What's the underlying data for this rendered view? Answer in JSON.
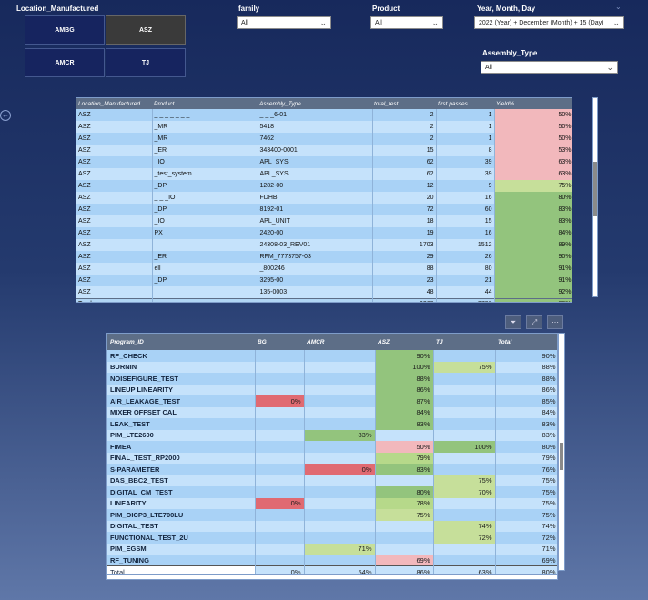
{
  "slicers": {
    "location": {
      "title": "Location_Manufactured",
      "tiles": [
        "AMBG",
        "ASZ",
        "AMCR",
        "TJ"
      ]
    },
    "family": {
      "title": "family",
      "value": "All"
    },
    "product": {
      "title": "Product",
      "value": "All"
    },
    "date": {
      "title": "Year, Month, Day",
      "value": "2022 (Year) + December (Month) + 15 (Day)"
    },
    "assembly": {
      "title": "Assembly_Type",
      "value": "All"
    }
  },
  "icons": {
    "chevron": "chevron-down-icon",
    "back": "back-arrow-icon",
    "filter": "filter-icon",
    "focus": "focus-mode-icon",
    "more": "more-options-icon"
  },
  "colors": {
    "red": "#e06a72",
    "pink": "#f2b8bc",
    "lightgreen": "#c6df9a",
    "green": "#93c47d",
    "lime": "#b6d98a"
  },
  "table1": {
    "headers": [
      "Location_Manufactured",
      "Product",
      "Assembly_Type",
      "total_test",
      "first passes",
      "Yield%"
    ],
    "rows": [
      [
        "ASZ",
        "_ _ _ _ _ _ _",
        "_ _ _6-01",
        "2",
        "1",
        "50%",
        "pink"
      ],
      [
        "ASZ",
        "_MR",
        "5418",
        "2",
        "1",
        "50%",
        "pink"
      ],
      [
        "ASZ",
        "_MR",
        "7462",
        "2",
        "1",
        "50%",
        "pink"
      ],
      [
        "ASZ",
        "_ER",
        "343400-0001",
        "15",
        "8",
        "53%",
        "pink"
      ],
      [
        "ASZ",
        "_IO",
        "APL_SYS",
        "62",
        "39",
        "63%",
        "pink"
      ],
      [
        "ASZ",
        "_test_system",
        "APL_SYS",
        "62",
        "39",
        "63%",
        "pink"
      ],
      [
        "ASZ",
        "_DP",
        "1282-00",
        "12",
        "9",
        "75%",
        "lightgreen"
      ],
      [
        "ASZ",
        "_ _ _IO",
        "FDHB",
        "20",
        "16",
        "80%",
        "green"
      ],
      [
        "ASZ",
        "_DP",
        "8192-01",
        "72",
        "60",
        "83%",
        "green"
      ],
      [
        "ASZ",
        "_IO",
        "APL_UNIT",
        "18",
        "15",
        "83%",
        "green"
      ],
      [
        "ASZ",
        "PX",
        "2420-00",
        "19",
        "16",
        "84%",
        "green"
      ],
      [
        "ASZ",
        "",
        "24308-03_REV01",
        "1703",
        "1512",
        "89%",
        "green"
      ],
      [
        "ASZ",
        "_ER",
        "RFM_7773757-03",
        "29",
        "26",
        "90%",
        "green"
      ],
      [
        "ASZ",
        "ell",
        "_800246",
        "88",
        "80",
        "91%",
        "green"
      ],
      [
        "ASZ",
        "_DP",
        "3295-00",
        "23",
        "21",
        "91%",
        "green"
      ],
      [
        "ASZ",
        "_ _",
        "135-0003",
        "48",
        "44",
        "92%",
        "green"
      ]
    ],
    "total": [
      "Total",
      "",
      "",
      "3260",
      "2798",
      "86%"
    ]
  },
  "table2": {
    "headers": [
      "Program_ID",
      "BG",
      "AMCR",
      "ASZ",
      "TJ",
      "Total"
    ],
    "rows": [
      [
        "RF_CHECK",
        "",
        "",
        "90%",
        "",
        "90%",
        [
          "",
          "",
          "green",
          ""
        ]
      ],
      [
        "BURNIN",
        "",
        "",
        "100%",
        "75%",
        "88%",
        [
          "",
          "",
          "green",
          "lightgreen"
        ]
      ],
      [
        "NOISEFIGURE_TEST",
        "",
        "",
        "88%",
        "",
        "88%",
        [
          "",
          "",
          "green",
          ""
        ]
      ],
      [
        "LINEUP LINEARITY",
        "",
        "",
        "86%",
        "",
        "86%",
        [
          "",
          "",
          "green",
          ""
        ]
      ],
      [
        "AIR_LEAKAGE_TEST",
        "0%",
        "",
        "87%",
        "",
        "85%",
        [
          "red",
          "",
          "green",
          ""
        ]
      ],
      [
        "MIXER OFFSET CAL",
        "",
        "",
        "84%",
        "",
        "84%",
        [
          "",
          "",
          "green",
          ""
        ]
      ],
      [
        "LEAK_TEST",
        "",
        "",
        "83%",
        "",
        "83%",
        [
          "",
          "",
          "green",
          ""
        ]
      ],
      [
        "PIM_LTE2600",
        "",
        "83%",
        "",
        "",
        "83%",
        [
          "",
          "green",
          "",
          ""
        ]
      ],
      [
        "FIMEA",
        "",
        "",
        "50%",
        "100%",
        "80%",
        [
          "",
          "",
          "pink",
          "green"
        ]
      ],
      [
        "FINAL_TEST_RP2000",
        "",
        "",
        "79%",
        "",
        "79%",
        [
          "",
          "",
          "lime",
          ""
        ]
      ],
      [
        "S-PARAMETER",
        "",
        "0%",
        "83%",
        "",
        "76%",
        [
          "",
          "red",
          "green",
          ""
        ]
      ],
      [
        "DAS_BBC2_TEST",
        "",
        "",
        "",
        "75%",
        "75%",
        [
          "",
          "",
          "",
          "lightgreen"
        ]
      ],
      [
        "DIGITAL_CM_TEST",
        "",
        "",
        "80%",
        "70%",
        "75%",
        [
          "",
          "",
          "green",
          "lightgreen"
        ]
      ],
      [
        "LINEARITY",
        "0%",
        "",
        "78%",
        "",
        "75%",
        [
          "red",
          "",
          "lime",
          ""
        ]
      ],
      [
        "PIM_OICP3_LTE700LU",
        "",
        "",
        "75%",
        "",
        "75%",
        [
          "",
          "",
          "lightgreen",
          ""
        ]
      ],
      [
        "DIGITAL_TEST",
        "",
        "",
        "",
        "74%",
        "74%",
        [
          "",
          "",
          "",
          "lightgreen"
        ]
      ],
      [
        "FUNCTIONAL_TEST_2U",
        "",
        "",
        "",
        "72%",
        "72%",
        [
          "",
          "",
          "",
          "lightgreen"
        ]
      ],
      [
        "PIM_EGSM",
        "",
        "71%",
        "",
        "",
        "71%",
        [
          "",
          "lightgreen",
          "",
          ""
        ]
      ],
      [
        "RF_TUNING",
        "",
        "",
        "69%",
        "",
        "69%",
        [
          "",
          "",
          "pink",
          ""
        ]
      ]
    ],
    "total": [
      "Total",
      "0%",
      "54%",
      "86%",
      "63%",
      "80%"
    ]
  }
}
